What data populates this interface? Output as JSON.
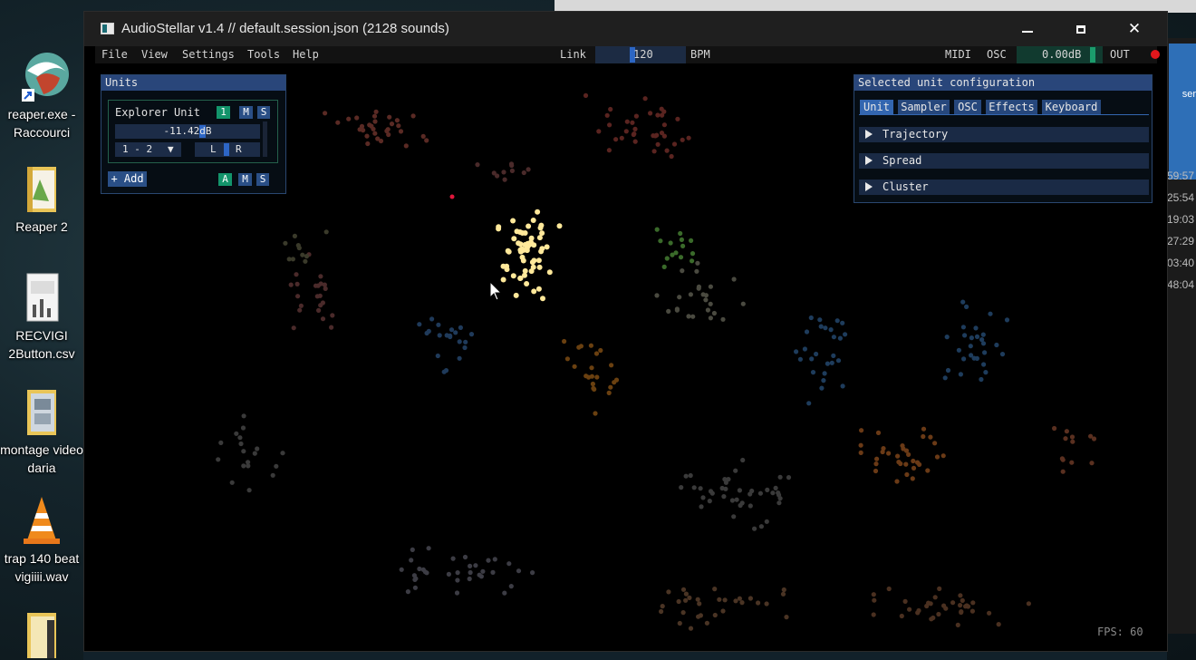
{
  "desktop": {
    "icons": [
      {
        "label": "reaper.exe -\nRaccourci",
        "icon": "reaper-app-icon"
      },
      {
        "label": "Reaper 2",
        "icon": "folder-icon"
      },
      {
        "label": "RECVIGI\n2Button.csv",
        "icon": "csv-file-icon"
      },
      {
        "label": "montage video\ndaria",
        "icon": "folder-icon"
      },
      {
        "label": "trap 140 beat\nvigiiii.wav",
        "icon": "vlc-icon"
      },
      {
        "label": "",
        "icon": "folder-icon"
      }
    ],
    "right_times": [
      "59:57",
      "25:54",
      "19:03",
      "27:29",
      "03:40",
      "48:04"
    ],
    "right_label": "ser"
  },
  "window": {
    "title": "AudioStellar v1.4 // default.session.json (2128 sounds)",
    "controls": {
      "minimize": "minimize-icon",
      "maximize": "maximize-icon",
      "close": "close-icon"
    }
  },
  "menubar": {
    "items": [
      "File",
      "View",
      "Settings",
      "Tools",
      "Help"
    ],
    "link_label": "Link",
    "bpm_value": "120",
    "bpm_label": "BPM",
    "midi_label": "MIDI",
    "osc_label": "OSC",
    "master_volume": "0.00dB",
    "out_label": "OUT"
  },
  "units_panel": {
    "title": "Units",
    "unit": {
      "name": "Explorer Unit",
      "index": "1",
      "mute": "M",
      "solo": "S",
      "volume": "-11.42dB",
      "channels": "1 - 2",
      "pan_left": "L",
      "pan_right": "R"
    },
    "add_label": "+ Add",
    "all_buttons": [
      "A",
      "M",
      "S"
    ]
  },
  "config_panel": {
    "title": "Selected unit configuration",
    "tabs": [
      "Unit",
      "Sampler",
      "OSC",
      "Effects",
      "Keyboard"
    ],
    "active_tab": "Unit",
    "sections": [
      "Trajectory",
      "Spread",
      "Cluster"
    ]
  },
  "status": {
    "fps": "FPS: 60"
  },
  "colors": {
    "accent_blue": "#29467a",
    "active_green": "#13946b",
    "record_red": "#e0171c",
    "selected_sounds": "#ffe89a"
  }
}
